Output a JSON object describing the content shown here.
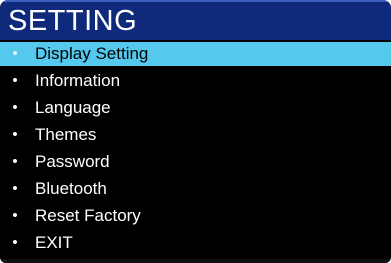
{
  "header": {
    "title": "SETTING"
  },
  "menu": {
    "bullet": "•",
    "selected_index": 0,
    "items": [
      {
        "label": "Display Setting"
      },
      {
        "label": "Information"
      },
      {
        "label": "Language"
      },
      {
        "label": "Themes"
      },
      {
        "label": "Password"
      },
      {
        "label": "Bluetooth"
      },
      {
        "label": "Reset Factory"
      },
      {
        "label": "EXIT"
      }
    ]
  },
  "colors": {
    "header_bg": "#0f2a7a",
    "screen_bg": "#000000",
    "highlight": "#55c8ed",
    "text": "#ffffff"
  }
}
